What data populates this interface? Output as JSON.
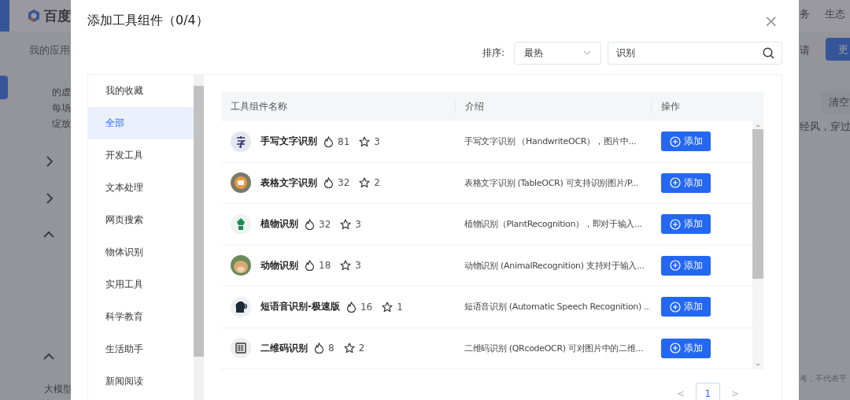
{
  "background": {
    "logo_text": "百度",
    "nav_items": [
      "务",
      "生态"
    ],
    "breadcrumb": "我的应用",
    "toolbar_text": "请",
    "toolbar_button": "更",
    "paragraph_lines": [
      "的虚",
      "每场",
      "绽放"
    ],
    "clear_button": "清空",
    "side_text": "经风，穿过",
    "section_label": "大模型",
    "footer_note": "考，不代表平"
  },
  "dialog": {
    "title": "添加工具组件（0/4）",
    "close": "×",
    "sort": {
      "label": "排序:",
      "value": "最热"
    },
    "search": {
      "value": "识别"
    },
    "categories": [
      {
        "label": "我的收藏",
        "selected": false
      },
      {
        "label": "全部",
        "selected": true
      },
      {
        "label": "开发工具",
        "selected": false
      },
      {
        "label": "文本处理",
        "selected": false
      },
      {
        "label": "网页搜索",
        "selected": false
      },
      {
        "label": "物体识别",
        "selected": false
      },
      {
        "label": "实用工具",
        "selected": false
      },
      {
        "label": "科学教育",
        "selected": false
      },
      {
        "label": "生活助手",
        "selected": false
      },
      {
        "label": "新闻阅读",
        "selected": false
      }
    ],
    "table": {
      "columns": [
        "工具组件名称",
        "介绍",
        "操作"
      ],
      "rows": [
        {
          "name": "手写文字识别",
          "hot": "81",
          "favorites": "3",
          "intro": "手写文字识别 （HandwriteOCR），图片中...",
          "action": "添加"
        },
        {
          "name": "表格文字识别",
          "hot": "32",
          "favorites": "2",
          "intro": "表格文字识别 (TableOCR) 可支持识别图片/P...",
          "action": "添加"
        },
        {
          "name": "植物识别",
          "hot": "32",
          "favorites": "3",
          "intro": "植物识别（PlantRecognition），即对于输入...",
          "action": "添加"
        },
        {
          "name": "动物识别",
          "hot": "18",
          "favorites": "3",
          "intro": "动物识别 (AnimalRecognition) 支持对于输入...",
          "action": "添加"
        },
        {
          "name": "短语音识别-极速版",
          "hot": "16",
          "favorites": "1",
          "intro": "短语音识别 (Automatic Speech Recognition) ...",
          "action": "添加"
        },
        {
          "name": "二维码识别",
          "hot": "8",
          "favorites": "2",
          "intro": "二维码识别 (QRcodeOCR) 可对图片中的二维...",
          "action": "添加"
        }
      ]
    },
    "pagination": {
      "prev": "<",
      "pages": [
        {
          "label": "1",
          "selected": true
        }
      ],
      "next": ">"
    }
  }
}
